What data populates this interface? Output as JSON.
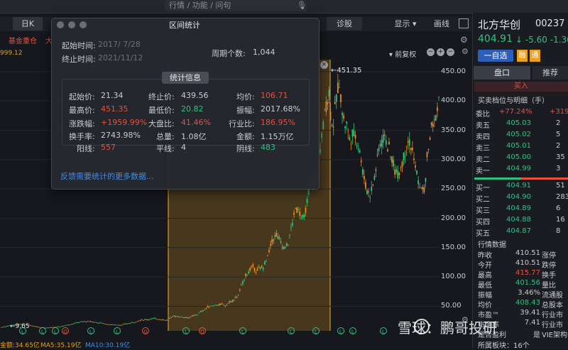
{
  "search": {
    "placeholder": "行情 / 功能 / 问句"
  },
  "toolbar": {
    "day_k": "日K",
    "fund_label": "基金重仓",
    "fund_label2": "大",
    "diagnose": "诊股",
    "display": "显示 ▾",
    "draw": "画线",
    "left_price": "999.12",
    "fuquan": "▾ 前复权"
  },
  "dialog": {
    "title": "区间统计",
    "start_time_label": "起始时间:",
    "start_time": "2017/  7/28",
    "end_time_label": "终止时间:",
    "end_time": "2021/11/12",
    "period_label": "周期个数:",
    "period_count": "1,044",
    "stats_header": "统计信息",
    "feedback": "反馈需要统计的更多数据..."
  },
  "stats": {
    "start_price_label": "起始价:",
    "start_price": "21.34",
    "end_price_label": "终止价:",
    "end_price": "439.56",
    "avg_label": "均价:",
    "avg": "106.71",
    "high_label": "最高价:",
    "high": "451.35",
    "low_label": "最低价:",
    "low": "20.82",
    "amp_label": "振幅:",
    "amp": "2017.68%",
    "chg_label": "涨跌幅:",
    "chg": "+1959.99%",
    "index_label": "大盘比:",
    "index": "41.46%",
    "industry_label": "行业比:",
    "industry": "186.95%",
    "turnover_label": "换手率:",
    "turnover": "2743.98%",
    "volume_label": "总量:",
    "volume": "1.08亿",
    "amount_label": "金额:",
    "amount": "1.15万亿",
    "up_label": "阳线:",
    "up": "557",
    "flat_label": "平线:",
    "flat": "4",
    "down_label": "阴线:",
    "down": "483"
  },
  "chart": {
    "high_marker": "←451.35",
    "low_marker": "←9.65",
    "y_ticks": [
      "450.00",
      "400.00",
      "350.00",
      "300.00",
      "250.00",
      "200.00",
      "150.00",
      "100.00",
      "50.00"
    ]
  },
  "status": {
    "amount": "金额:34.65亿",
    "ma5": "MA5:35.19亿",
    "ma10": "MA10:30.19亿"
  },
  "stock": {
    "name": "北方华创",
    "code": "00237",
    "price": "404.91",
    "change": "↓ -5.60  -1.36",
    "watch": "一自选",
    "margin": "融",
    "tong": "通"
  },
  "panel": {
    "tab1": "盘口",
    "tab2": "推荐",
    "buy_bar": "买入",
    "order_title": "买卖档位与明细（手）",
    "weibi_label": "委比",
    "weibi": "+77.24%",
    "weibi_r": "+319",
    "sells": [
      {
        "label": "卖五",
        "price": "405.03",
        "vol": "2"
      },
      {
        "label": "卖四",
        "price": "405.02",
        "vol": "5"
      },
      {
        "label": "卖三",
        "price": "405.01",
        "vol": "2"
      },
      {
        "label": "卖二",
        "price": "405.00",
        "vol": "35"
      },
      {
        "label": "卖一",
        "price": "404.99",
        "vol": "3"
      }
    ],
    "buys": [
      {
        "label": "买一",
        "price": "404.91",
        "vol": "51"
      },
      {
        "label": "买二",
        "price": "404.90",
        "vol": "283"
      },
      {
        "label": "买三",
        "price": "404.89",
        "vol": "6"
      },
      {
        "label": "买四",
        "price": "404.88",
        "vol": "16"
      },
      {
        "label": "买五",
        "price": "404.87",
        "vol": "8"
      }
    ],
    "quote_title": "行情数据",
    "quotes": [
      {
        "label": "昨收",
        "value": "410.51",
        "color": "#c9ccd2",
        "label2": "涨停"
      },
      {
        "label": "今开",
        "value": "410.51",
        "color": "#c9ccd2",
        "label2": "跌停"
      },
      {
        "label": "最高",
        "value": "415.77",
        "color": "#e8513e",
        "label2": "换手"
      },
      {
        "label": "最低",
        "value": "401.56",
        "color": "#2ec27e",
        "label2": "量比"
      },
      {
        "label": "振幅",
        "value": "3.46%",
        "color": "#c9ccd2",
        "label2": "流通股"
      },
      {
        "label": "均价",
        "value": "408.43",
        "color": "#2ec27e",
        "label2": "总股本"
      },
      {
        "label": "市盈™",
        "value": "39.41",
        "color": "#c9ccd2",
        "label2": "行业市"
      },
      {
        "label": "市净率",
        "value": "7.41",
        "color": "#c9ccd2",
        "label2": "行业市"
      },
      {
        "label": "是否盈利",
        "value": "是",
        "color": "#c9ccd2",
        "label2": "VIE架构"
      }
    ],
    "sector": "所属板块：16个"
  },
  "watermark": "雪球：鹏哥投研",
  "colors": {
    "up": "#e8513e",
    "down": "#2ec27e",
    "highlight": "#c9891f",
    "accent": "#3f8ee8"
  }
}
